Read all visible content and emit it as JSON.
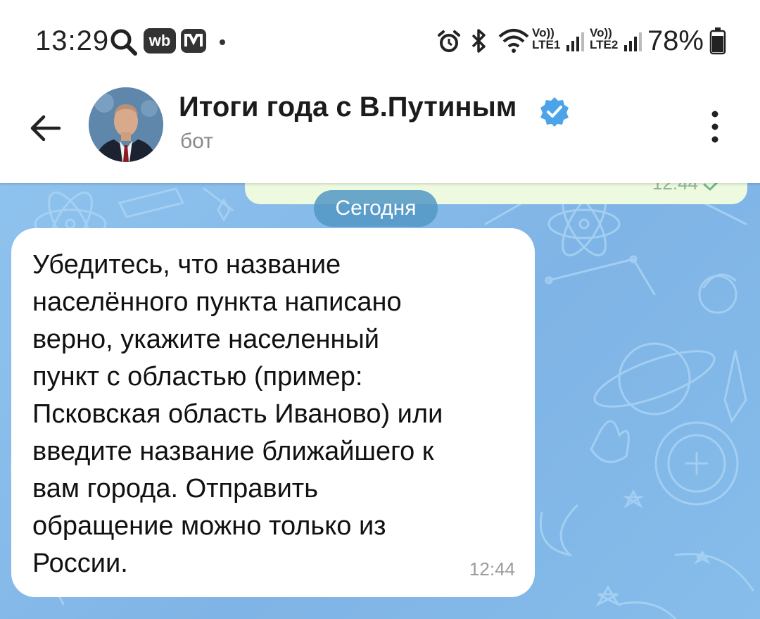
{
  "status_bar": {
    "time": "13:29",
    "battery": "78%",
    "lte1": "LTE1",
    "lte2": "LTE2",
    "volte": "Vo))",
    "notification_icons": [
      "search-icon",
      "wb-app-icon",
      "m-app-icon"
    ],
    "system_icons": [
      "alarm-icon",
      "bluetooth-icon",
      "wifi-icon",
      "signal-icon",
      "signal-icon",
      "battery-icon"
    ],
    "wb_label": "wb"
  },
  "header": {
    "title": "Итоги года с В.Путиным",
    "subtitle": "бот",
    "verified_color": "#4ca3ea"
  },
  "chat": {
    "previous_message_time": "12:44",
    "date_label": "Сегодня",
    "message": {
      "text": "Убедитесь, что название\nнаселённого пункта написано\nверно, укажите  населенный\nпункт с областью (пример:\nПсковская область Иваново) или\nвведите название ближайшего к\nвам города. Отправить\nобращение можно только из\nРоссии.",
      "time": "12:44"
    },
    "background_color": "#86bdea",
    "outgoing_bubble_color": "#eefadf"
  }
}
